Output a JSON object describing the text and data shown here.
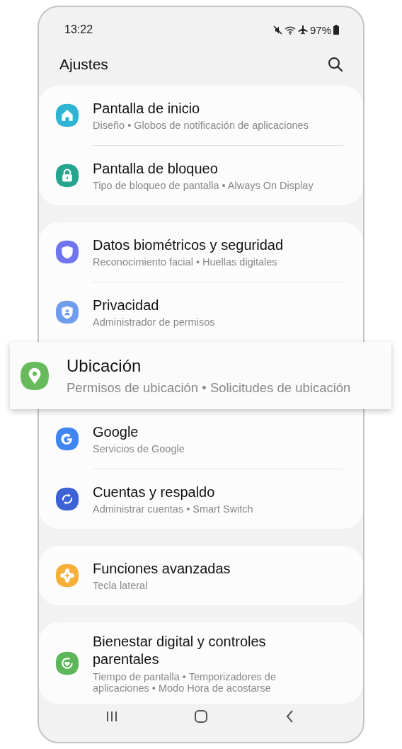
{
  "status_bar": {
    "time": "13:22",
    "battery": "97%"
  },
  "header": {
    "title": "Ajustes"
  },
  "groups": [
    {
      "items": [
        {
          "kind": "row",
          "title": "Pantalla de inicio",
          "subtitle": "Diseño • Globos de notificación de aplicaciones",
          "color": "#2fb5d3"
        },
        {
          "kind": "row",
          "title": "Pantalla de bloqueo",
          "subtitle": "Tipo de bloqueo de pantalla • Always On Display",
          "color": "#26a58e"
        }
      ]
    },
    {
      "items": [
        {
          "kind": "row",
          "title": "Datos biométricos y seguridad",
          "subtitle": "Reconocimiento facial • Huellas digitales",
          "color": "#7074ef"
        },
        {
          "kind": "row",
          "title": "Privacidad",
          "subtitle": "Administrador de permisos",
          "color": "#709deb"
        },
        {
          "kind": "popout",
          "title": "Ubicación",
          "subtitle": "Permisos de ubicación • Solicitudes de ubicación",
          "color": "#67bb5c"
        },
        {
          "kind": "row",
          "title": "Google",
          "subtitle": "Servicios de Google",
          "color": "#3f86f0"
        },
        {
          "kind": "row",
          "title": "Cuentas y respaldo",
          "subtitle": "Administrar cuentas • Smart Switch",
          "color": "#3d62d6"
        }
      ]
    },
    {
      "items": [
        {
          "kind": "row",
          "title": "Funciones avanzadas",
          "subtitle": "Tecla lateral",
          "color": "#f6b03a"
        }
      ]
    },
    {
      "items": [
        {
          "kind": "row",
          "title": "Bienestar digital y controles parentales",
          "subtitle": "Tiempo de pantalla • Temporizadores de aplicaciones • Modo Hora de acostarse",
          "color": "#5db65a"
        }
      ]
    }
  ]
}
